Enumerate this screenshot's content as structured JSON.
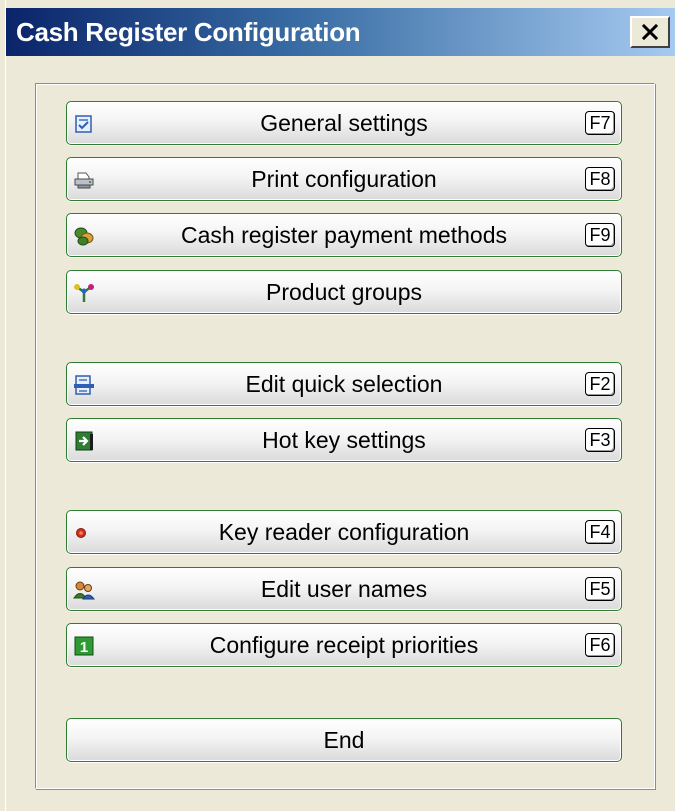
{
  "window": {
    "title": "Cash Register Configuration",
    "close_label": "×"
  },
  "colors": {
    "title_gradient_start": "#0a246a",
    "title_gradient_end": "#a6caf0",
    "button_border": "#2e7d32",
    "background": "#ece9d8"
  },
  "buttons": [
    {
      "label": "General settings",
      "key": "F7",
      "icon": "checklist-icon"
    },
    {
      "label": "Print configuration",
      "key": "F8",
      "icon": "printer-icon"
    },
    {
      "label": "Cash register payment methods",
      "key": "F9",
      "icon": "coins-icon"
    },
    {
      "label": "Product groups",
      "key": "",
      "icon": "product-groups-icon"
    },
    {
      "label": "Edit quick selection",
      "key": "F2",
      "icon": "quick-selection-icon"
    },
    {
      "label": "Hot key settings",
      "key": "F3",
      "icon": "hotkey-icon"
    },
    {
      "label": "Key reader configuration",
      "key": "F4",
      "icon": "key-reader-icon"
    },
    {
      "label": "Edit user names",
      "key": "F5",
      "icon": "users-icon"
    },
    {
      "label": "Configure receipt priorities",
      "key": "F6",
      "icon": "priority-icon"
    },
    {
      "label": "End",
      "key": "",
      "icon": ""
    }
  ]
}
